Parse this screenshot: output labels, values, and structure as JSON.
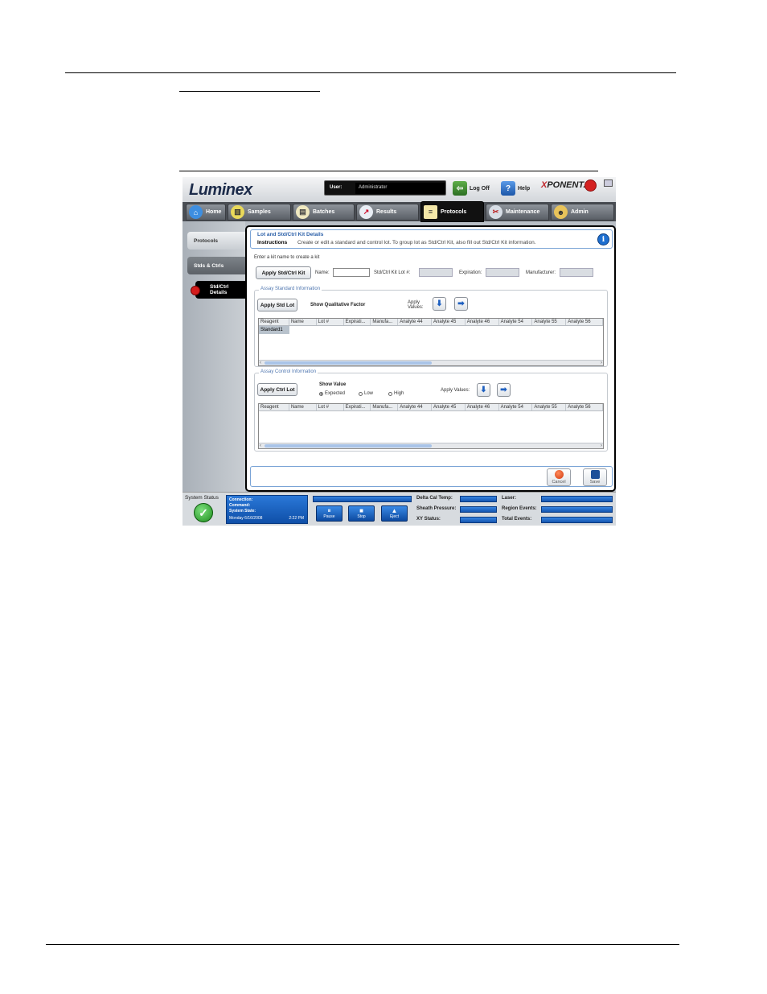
{
  "app": {
    "brand": "Luminex",
    "product": "xPONENT"
  },
  "header": {
    "user_label": "User:",
    "user_value": "Administrator",
    "logoff_label": "Log Off",
    "help_label": "Help",
    "brand_logo": "XPONENT"
  },
  "tabs": [
    {
      "label": "Home",
      "icon": "home-icon"
    },
    {
      "label": "Samples",
      "icon": "samples-icon"
    },
    {
      "label": "Batches",
      "icon": "batches-icon"
    },
    {
      "label": "Results",
      "icon": "results-icon"
    },
    {
      "label": "Protocols",
      "icon": "protocols-icon",
      "active": true
    },
    {
      "label": "Maintenance",
      "icon": "maintenance-icon"
    },
    {
      "label": "Admin",
      "icon": "admin-icon"
    }
  ],
  "sidebar": {
    "items": [
      {
        "label": "Protocols"
      },
      {
        "label": "Stds & Ctrls"
      },
      {
        "label": "Std/Ctrl Details",
        "active": true
      }
    ]
  },
  "panel": {
    "title": "Lot and Std/Ctrl Kit Details",
    "instructions_label": "Instructions",
    "instructions_text": "Create or edit a standard and control lot.  To group lot as Std/Ctrl Kit, also fill out Std/Ctrl Kit information.",
    "kit_prompt": "Enter a kit name to create a kit",
    "apply_kit_label": "Apply Std/Ctrl Kit",
    "name_label": "Name:",
    "name_value": "",
    "kit_lot_label": "Std/Ctrl Kit Lot #:",
    "expiration_label": "Expiration:",
    "manufacturer_label": "Manufacturer:"
  },
  "standard_group": {
    "title": "Assay Standard Information",
    "apply_lot_label": "Apply Std Lot",
    "show_factor_label": "Show Qualitative Factor",
    "apply_values_label": "Apply Values:",
    "columns": [
      "Reagent",
      "Name",
      "Lot #",
      "Expirati...",
      "Manufa...",
      "Analyte 44",
      "Analyte 45",
      "Analyte 46",
      "Analyte 54",
      "Analyte 55",
      "Analyte 56"
    ],
    "rows": [
      [
        "Standard1"
      ]
    ]
  },
  "control_group": {
    "title": "Assay Control Information",
    "apply_lot_label": "Apply Ctrl Lot",
    "show_value_label": "Show Value",
    "options": [
      "Expected",
      "Low",
      "High"
    ],
    "selected_option": "Expected",
    "apply_values_label": "Apply Values:",
    "columns": [
      "Reagent",
      "Name",
      "Lot #",
      "Expirati...",
      "Manufa...",
      "Analyte 44",
      "Analyte 45",
      "Analyte 46",
      "Analyte 54",
      "Analyte 55",
      "Analyte 56"
    ],
    "rows": []
  },
  "footer": {
    "cancel_label": "Cancel",
    "save_label": "Save"
  },
  "status": {
    "title": "System Status",
    "connection_label": "Connection:",
    "command_label": "Command:",
    "state_label": "System State:",
    "date": "Monday 6/16/2008",
    "time": "2:22 PM",
    "pause_label": "Pause",
    "stop_label": "Stop",
    "eject_label": "Eject",
    "delta_label": "Delta Cal Temp:",
    "sheath_label": "Sheath Pressure:",
    "xy_label": "XY Status:",
    "laser_label": "Laser:",
    "region_label": "Region Events:",
    "total_label": "Total Events:"
  },
  "colors": {
    "accent": "#2a5fa8",
    "status_blue": "#1a66c8",
    "active_tab": "#111111",
    "alert_red": "#d42020"
  }
}
